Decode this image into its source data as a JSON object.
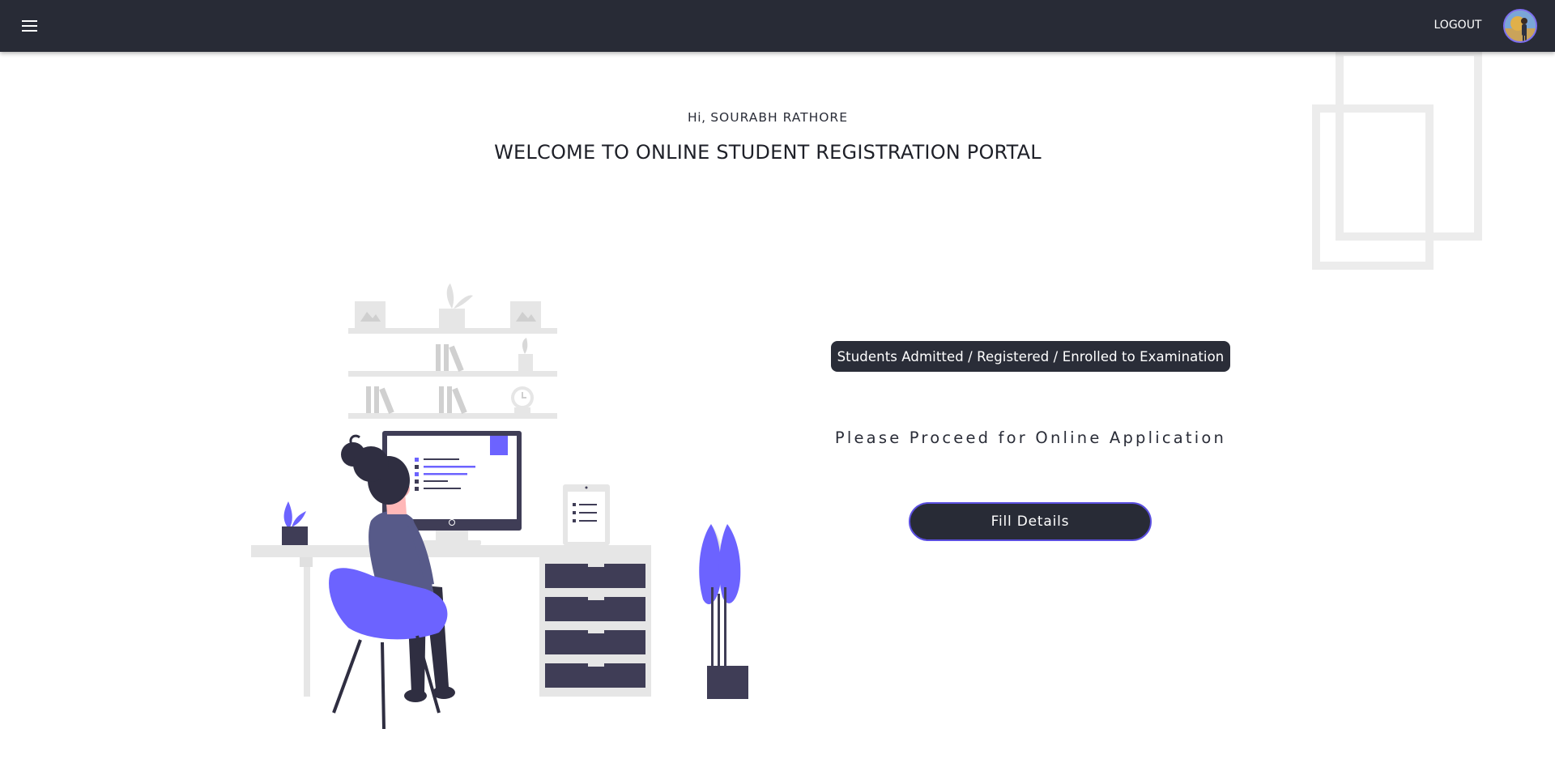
{
  "header": {
    "menu_icon": "hamburger-menu-icon",
    "logout_label": "LOGOUT",
    "avatar_icon": "user-avatar"
  },
  "welcome": {
    "greeting_prefix": "Hi,",
    "user_name": "SOURABH RATHORE",
    "title": "WELCOME TO ONLINE STUDENT REGISTRATION PORTAL"
  },
  "status": {
    "badge_text": "Students Admitted / Registered / Enrolled to Examination",
    "message": "Please Proceed for Online Application",
    "fill_button_label": "Fill Details"
  },
  "colors": {
    "header_bg": "#282b36",
    "accent_purple": "#6c63ff",
    "dark_ink": "#3f3d56"
  }
}
